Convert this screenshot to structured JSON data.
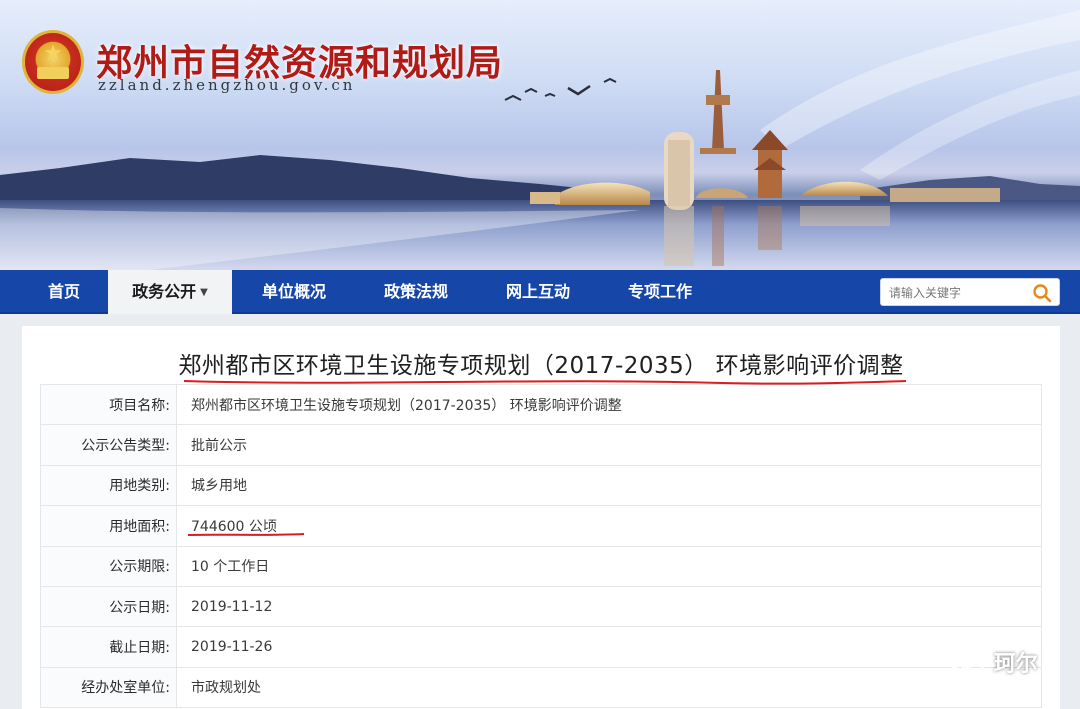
{
  "header": {
    "site_title": "郑州市自然资源和规划局",
    "site_url": "zzland.zhengzhou.gov.cn"
  },
  "nav": {
    "items": [
      {
        "label": "首页"
      },
      {
        "label": "政务公开",
        "active": true
      },
      {
        "label": "单位概况"
      },
      {
        "label": "政策法规"
      },
      {
        "label": "网上互动"
      },
      {
        "label": "专项工作"
      }
    ],
    "search": {
      "placeholder": "请输入关键字"
    }
  },
  "notice": {
    "title": "郑州都市区环境卫生设施专项规划（2017-2035） 环境影响评价调整",
    "rows": [
      {
        "label": "项目名称:",
        "value": "郑州都市区环境卫生设施专项规划（2017-2035） 环境影响评价调整"
      },
      {
        "label": "公示公告类型:",
        "value": "批前公示"
      },
      {
        "label": "用地类别:",
        "value": "城乡用地"
      },
      {
        "label": "用地面积:",
        "value": "744600 公顷"
      },
      {
        "label": "公示期限:",
        "value": "10 个工作日"
      },
      {
        "label": "公示日期:",
        "value": "2019-11-12"
      },
      {
        "label": "截止日期:",
        "value": "2019-11-26"
      },
      {
        "label": "经办处室单位:",
        "value": "市政规划处"
      }
    ]
  },
  "watermark": {
    "text": "珂尔"
  },
  "colors": {
    "nav_bg": "#1546a8",
    "title_red": "#b01b18",
    "annotation_red": "#d81e1e"
  }
}
